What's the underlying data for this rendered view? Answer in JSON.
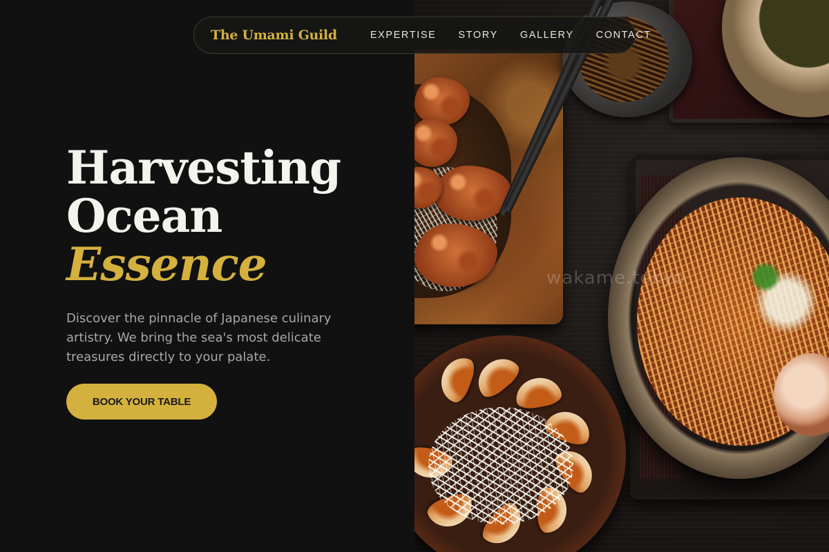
{
  "brand": {
    "name": "The Umami Guild"
  },
  "nav": {
    "links": [
      {
        "label": "EXPERTISE"
      },
      {
        "label": "STORY"
      },
      {
        "label": "GALLERY"
      },
      {
        "label": "CONTACT"
      }
    ]
  },
  "hero": {
    "title_line1": "Harvesting",
    "title_line2": "Ocean",
    "title_accent": "Essence",
    "description": "Discover the pinnacle of Japanese culinary artistry. We bring the sea's most delicate treasures directly to your palate.",
    "cta_label": "BOOK YOUR TABLE"
  },
  "photo": {
    "watermark": "wakame.tokyo"
  },
  "colors": {
    "background": "#111111",
    "accent_gold": "#d4b13e",
    "heading_white": "#f5f3ee",
    "body_gray": "#a8a8a8"
  }
}
